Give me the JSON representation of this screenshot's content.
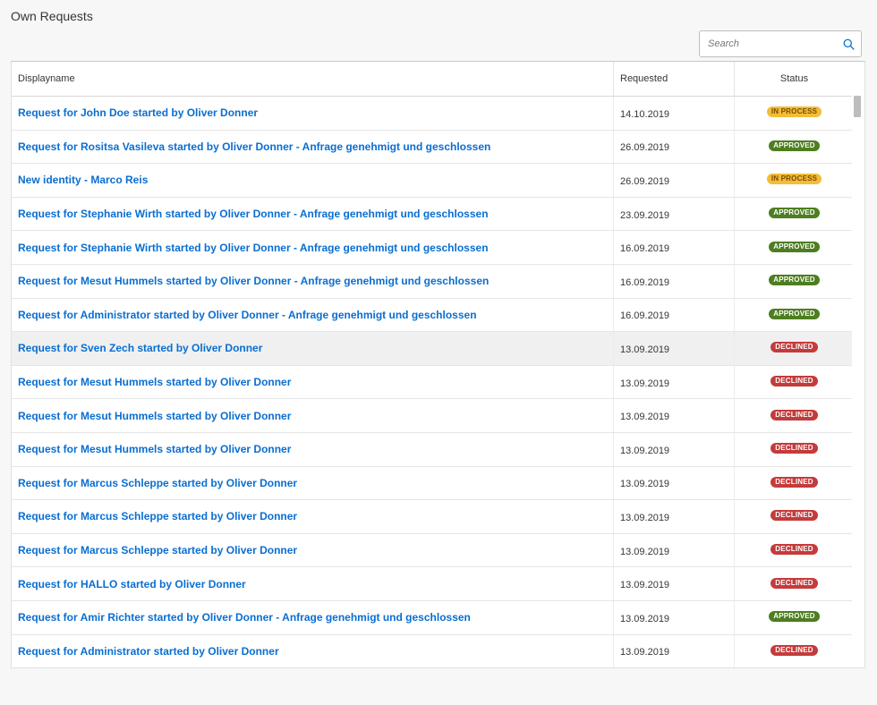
{
  "page": {
    "title": "Own Requests"
  },
  "search": {
    "placeholder": "Search",
    "icon": "search-icon"
  },
  "table": {
    "columns": [
      "Displayname",
      "Requested",
      "Status"
    ],
    "status_colors": {
      "IN PROCESS": {
        "bg": "#f2bd38",
        "fg": "#7a4b00"
      },
      "APPROVED": {
        "bg": "#4d7e1f",
        "fg": "#ffffff"
      },
      "DECLINED": {
        "bg": "#c43b3b",
        "fg": "#ffffff"
      }
    },
    "link_color": "#0a6ed1",
    "hovered_row_index": 7,
    "rows": [
      {
        "name": "Request for John Doe started by Oliver Donner",
        "date": "14.10.2019",
        "status": "IN PROCESS"
      },
      {
        "name": "Request for Rositsa Vasileva started by Oliver Donner - Anfrage genehmigt und geschlossen",
        "date": "26.09.2019",
        "status": "APPROVED"
      },
      {
        "name": "New identity - Marco Reis",
        "date": "26.09.2019",
        "status": "IN PROCESS"
      },
      {
        "name": "Request for Stephanie Wirth started by Oliver Donner - Anfrage genehmigt und geschlossen",
        "date": "23.09.2019",
        "status": "APPROVED"
      },
      {
        "name": "Request for Stephanie Wirth started by Oliver Donner - Anfrage genehmigt und geschlossen",
        "date": "16.09.2019",
        "status": "APPROVED"
      },
      {
        "name": "Request for Mesut Hummels started by Oliver Donner - Anfrage genehmigt und geschlossen",
        "date": "16.09.2019",
        "status": "APPROVED"
      },
      {
        "name": "Request for Administrator started by Oliver Donner - Anfrage genehmigt und geschlossen",
        "date": "16.09.2019",
        "status": "APPROVED"
      },
      {
        "name": "Request for Sven Zech started by Oliver Donner",
        "date": "13.09.2019",
        "status": "DECLINED"
      },
      {
        "name": "Request for Mesut Hummels started by Oliver Donner",
        "date": "13.09.2019",
        "status": "DECLINED"
      },
      {
        "name": "Request for Mesut Hummels started by Oliver Donner",
        "date": "13.09.2019",
        "status": "DECLINED"
      },
      {
        "name": "Request for Mesut Hummels started by Oliver Donner",
        "date": "13.09.2019",
        "status": "DECLINED"
      },
      {
        "name": "Request for Marcus Schleppe started by Oliver Donner",
        "date": "13.09.2019",
        "status": "DECLINED"
      },
      {
        "name": "Request for Marcus Schleppe started by Oliver Donner",
        "date": "13.09.2019",
        "status": "DECLINED"
      },
      {
        "name": "Request for Marcus Schleppe started by Oliver Donner",
        "date": "13.09.2019",
        "status": "DECLINED"
      },
      {
        "name": "Request for HALLO started by Oliver Donner",
        "date": "13.09.2019",
        "status": "DECLINED"
      },
      {
        "name": "Request for Amir Richter started by Oliver Donner - Anfrage genehmigt und geschlossen",
        "date": "13.09.2019",
        "status": "APPROVED"
      },
      {
        "name": "Request for Administrator started by Oliver Donner",
        "date": "13.09.2019",
        "status": "DECLINED"
      }
    ]
  }
}
